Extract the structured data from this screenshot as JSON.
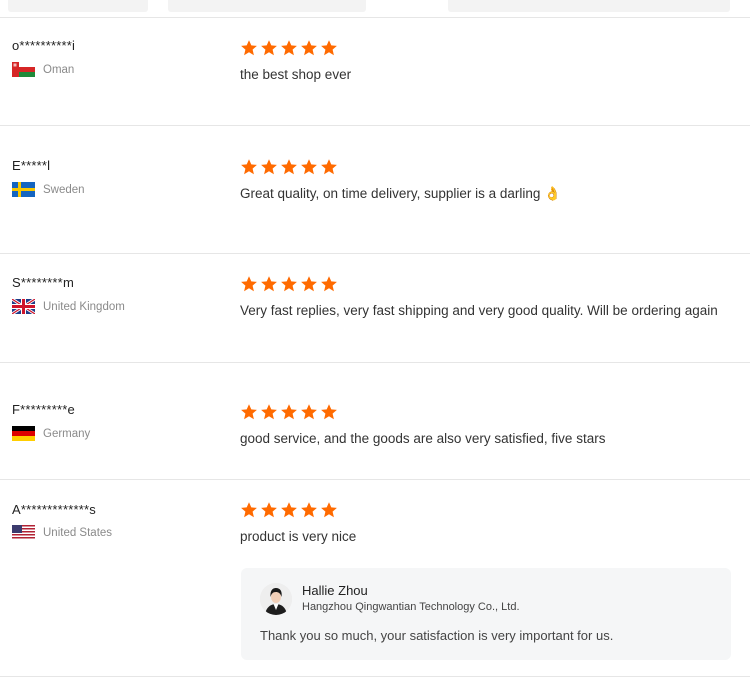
{
  "reviews": [
    {
      "name": "o**********i",
      "country": "Oman",
      "flag_icon": "oman-flag-icon",
      "rating": 5,
      "comment": "the best shop ever"
    },
    {
      "name": "E*****l",
      "country": "Sweden",
      "flag_icon": "sweden-flag-icon",
      "rating": 5,
      "comment": "Great quality, on time delivery, supplier is a darling 👌"
    },
    {
      "name": "S********m",
      "country": "United Kingdom",
      "flag_icon": "uk-flag-icon",
      "rating": 5,
      "comment": "Very fast replies, very fast shipping and very good quality. Will be ordering again"
    },
    {
      "name": "F*********e",
      "country": "Germany",
      "flag_icon": "germany-flag-icon",
      "rating": 5,
      "comment": "good service, and the goods are also very satisfied, five stars"
    },
    {
      "name": "A*************s",
      "country": "United States",
      "flag_icon": "usa-flag-icon",
      "rating": 5,
      "comment": "product is very nice"
    }
  ],
  "reply": {
    "name": "Hallie Zhou",
    "company": "Hangzhou Qingwantian Technology Co., Ltd.",
    "text": "Thank you so much, your satisfaction is very important for us."
  },
  "colors": {
    "star": "#ff6a00",
    "divider": "#e6e6e6",
    "reply_bg": "#f5f6f7"
  }
}
